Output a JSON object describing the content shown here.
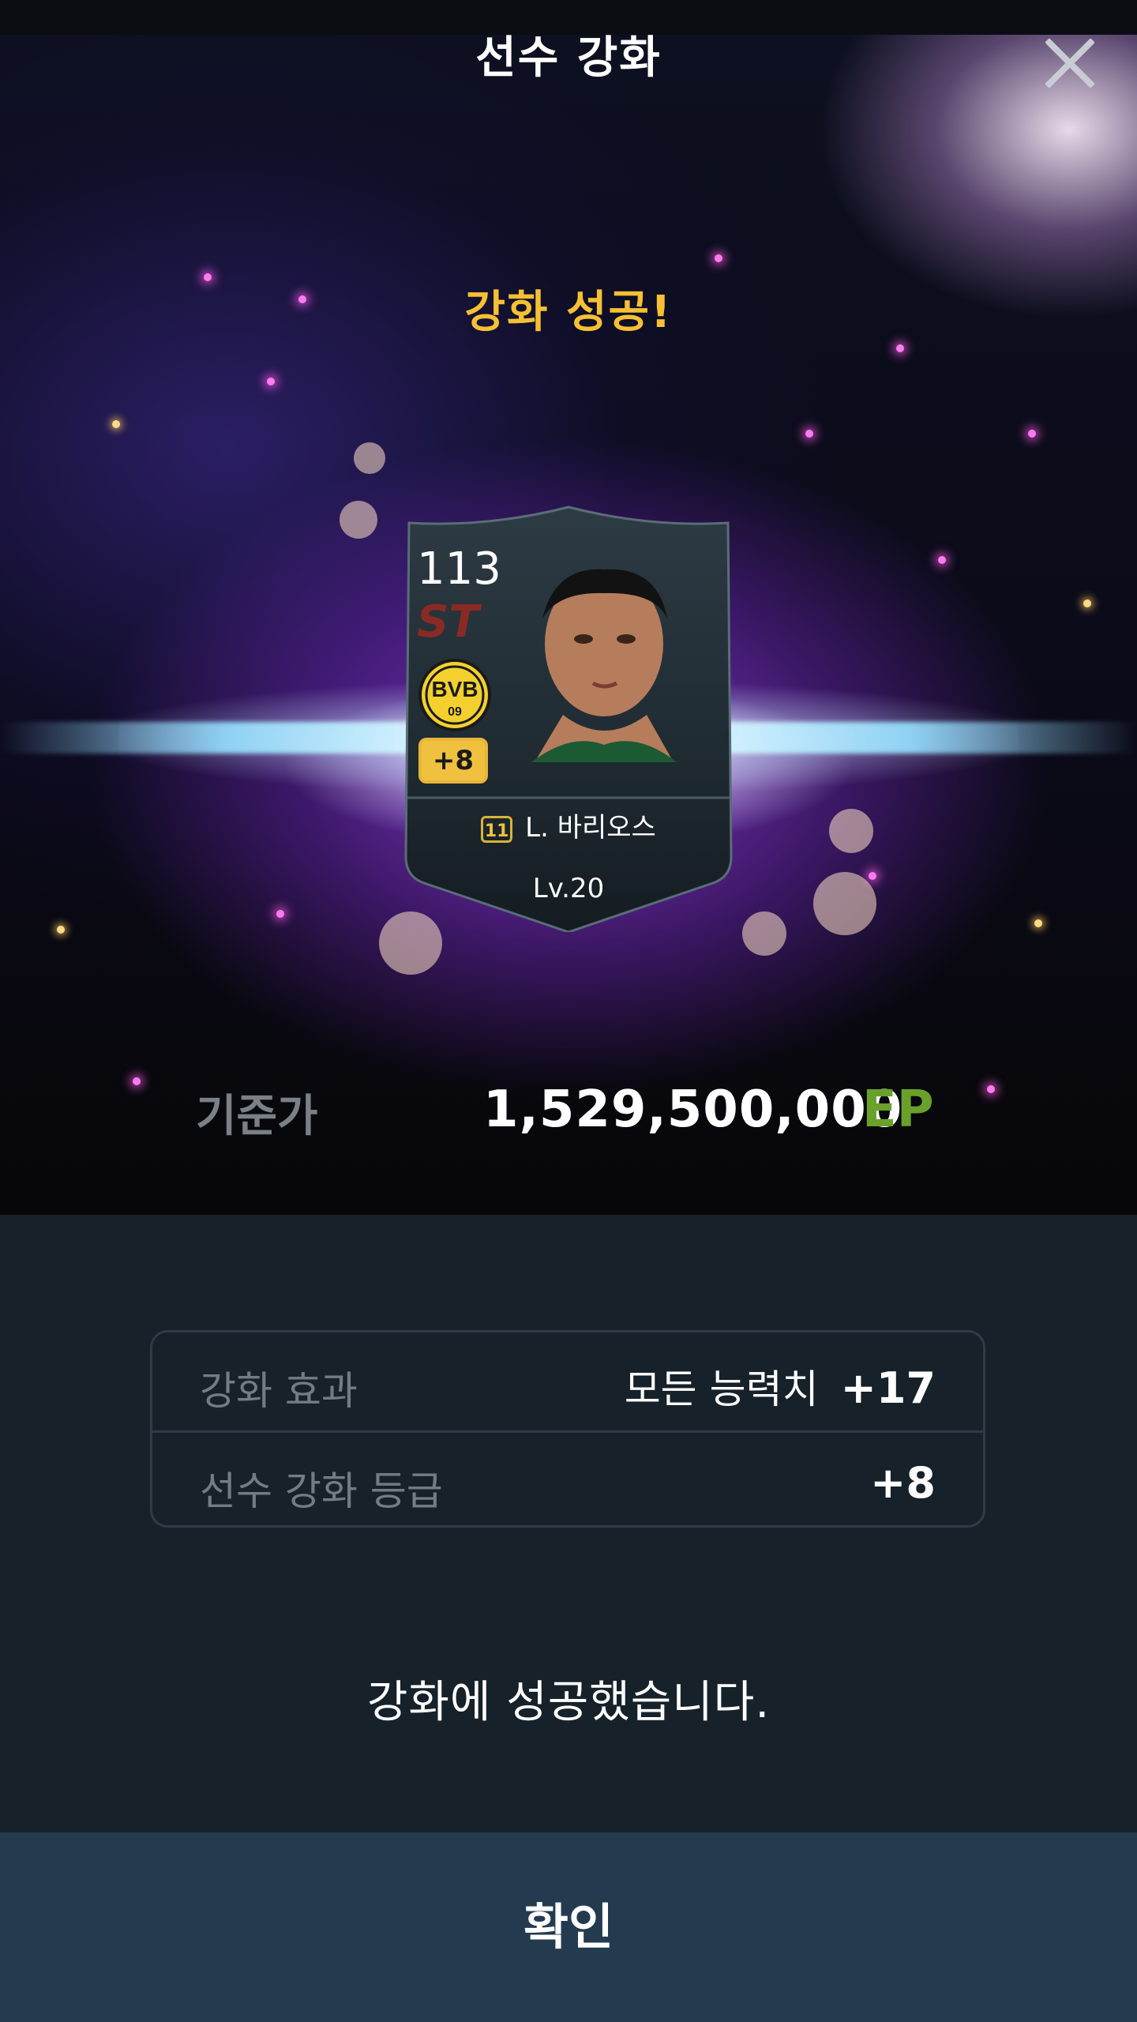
{
  "header": {
    "title": "선수 강화"
  },
  "result": {
    "headline": "강화 성공!"
  },
  "card": {
    "ovr": "113",
    "position": "ST",
    "club": "BVB",
    "club_year": "09",
    "upgrade_badge": "+8",
    "season_icon": "11",
    "player_name": "L. 바리오스",
    "level": "Lv.20"
  },
  "price": {
    "label": "기준가",
    "value": "1,529,500,000",
    "currency": "EP"
  },
  "info": {
    "rows": [
      {
        "label": "강화 효과",
        "desc": "모든 능력치",
        "value": "+17"
      },
      {
        "label": "선수 강화 등급",
        "desc": "",
        "value": "+8"
      }
    ]
  },
  "message": "강화에 성공했습니다.",
  "confirm_label": "확인",
  "colors": {
    "gold": "#f5c033",
    "ep_green": "#6aa12a",
    "position_red": "#8a2a24",
    "button_bg": "#243a4f"
  }
}
